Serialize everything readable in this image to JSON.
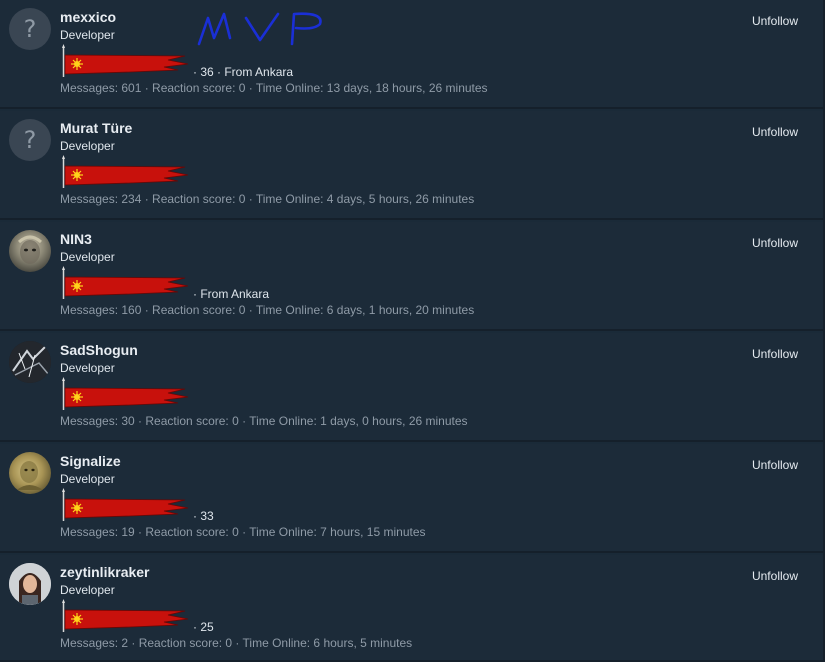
{
  "unfollow_label": "Unfollow",
  "members": [
    {
      "username": "mexxico",
      "role": "Developer",
      "extra": "· 36 · From Ankara",
      "stats": "Messages: 601 · Reaction score: 0 · Time Online: 13 days, 18 hours, 26 minutes",
      "avatar": "placeholder"
    },
    {
      "username": "Murat Türe",
      "role": "Developer",
      "extra": "",
      "stats": "Messages: 234 · Reaction score: 0 · Time Online: 4 days, 5 hours, 26 minutes",
      "avatar": "placeholder"
    },
    {
      "username": "NIN3",
      "role": "Developer",
      "extra": "· From Ankara",
      "stats": "Messages: 160 · Reaction score: 0 · Time Online: 6 days, 1 hours, 20 minutes",
      "avatar": "photo"
    },
    {
      "username": "SadShogun",
      "role": "Developer",
      "extra": "",
      "stats": "Messages: 30 · Reaction score: 0 · Time Online: 1 days, 0 hours, 26 minutes",
      "avatar": "photo"
    },
    {
      "username": "Signalize",
      "role": "Developer",
      "extra": "· 33",
      "stats": "Messages: 19 · Reaction score: 0 · Time Online: 7 hours, 15 minutes",
      "avatar": "photo"
    },
    {
      "username": "zeytinlikraker",
      "role": "Developer",
      "extra": "· 25",
      "stats": "Messages: 2 · Reaction score: 0 · Time Online: 6 hours, 5 minutes",
      "avatar": "photo"
    }
  ],
  "annotation": {
    "text": "MVP",
    "color": "#1a2fd6"
  },
  "colors": {
    "background": "#1c2b39",
    "banner_red": "#c8110c",
    "banner_sun": "#ffd21a"
  }
}
